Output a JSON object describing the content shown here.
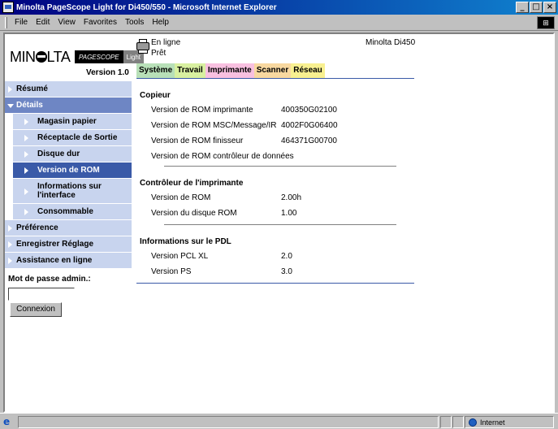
{
  "window": {
    "title": "Minolta PageScope Light for Di450/550 - Microsoft Internet Explorer"
  },
  "menubar": {
    "items": [
      "File",
      "Edit",
      "View",
      "Favorites",
      "Tools",
      "Help"
    ]
  },
  "brand": {
    "logo_text": "MINOLTA",
    "pagescope": "PAGESCOPE",
    "light": "Light",
    "version": "Version 1.0"
  },
  "nav": {
    "items": [
      {
        "label": "Résumé",
        "level": "top"
      },
      {
        "label": "Détails",
        "level": "open"
      },
      {
        "label": "Magasin papier",
        "level": "sub"
      },
      {
        "label": "Réceptacle de Sortie",
        "level": "sub"
      },
      {
        "label": "Disque dur",
        "level": "sub"
      },
      {
        "label": "Version de ROM",
        "level": "sub-active"
      },
      {
        "label": "Informations sur l'interface",
        "level": "sub-tall"
      },
      {
        "label": "Consommable",
        "level": "sub"
      },
      {
        "label": "Préférence",
        "level": "top"
      },
      {
        "label": "Enregistrer Réglage",
        "level": "top"
      },
      {
        "label": "Assistance en ligne",
        "level": "top"
      }
    ]
  },
  "login": {
    "label": "Mot de passe admin.:",
    "value": "",
    "button": "Connexion"
  },
  "status": {
    "line1": "En ligne",
    "line2": "Prêt",
    "model": "Minolta Di450"
  },
  "tabs": [
    {
      "label": "Système",
      "color": "#b8e0b8"
    },
    {
      "label": "Travail",
      "color": "#d8f0a0"
    },
    {
      "label": "Imprimante",
      "color": "#f8c0e0"
    },
    {
      "label": "Scanner",
      "color": "#f8d8a0"
    },
    {
      "label": "Réseau",
      "color": "#f8f090"
    }
  ],
  "sections": {
    "copieur": {
      "title": "Copieur",
      "rows": [
        {
          "label": "Version de ROM imprimante",
          "value": "400350G02100"
        },
        {
          "label": "Version de ROM MSC/Message/IR",
          "value": "4002F0G06400"
        },
        {
          "label": "Version de ROM finisseur",
          "value": "464371G00700"
        },
        {
          "label": "Version de ROM contrôleur de données",
          "value": ""
        }
      ]
    },
    "controleur": {
      "title": "Contrôleur de l'imprimante",
      "rows": [
        {
          "label": "Version de ROM",
          "value": "2.00h"
        },
        {
          "label": "Version du disque ROM",
          "value": "1.00"
        }
      ]
    },
    "pdl": {
      "title": "Informations sur le PDL",
      "rows": [
        {
          "label": "Version PCL XL",
          "value": "2.0"
        },
        {
          "label": "Version PS",
          "value": "3.0"
        }
      ]
    }
  },
  "statusbar": {
    "zone": "Internet"
  }
}
